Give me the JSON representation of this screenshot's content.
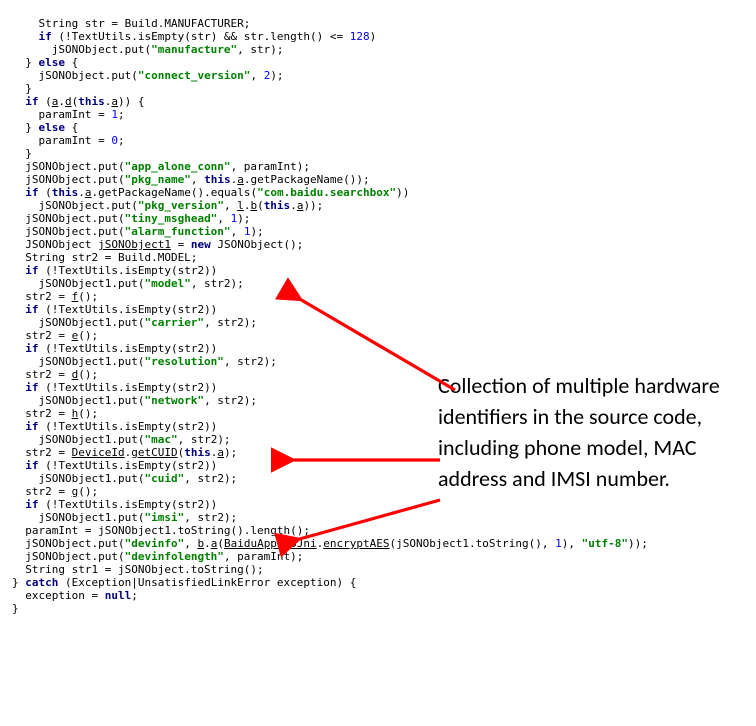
{
  "callout_text": "Collection of multiple hardware identifiers in the source code, including phone model, MAC address and IMSI number.",
  "code": {
    "lines": [
      "    String str = Build.MANUFACTURER;",
      "    if (!TextUtils.isEmpty(str) && str.length() <= 128)",
      "      jSONObject.put(\"manufacture\", str);",
      "  } else {",
      "    jSONObject.put(\"connect_version\", 2);",
      "  }",
      "  if (a.d(this.a)) {",
      "    paramInt = 1;",
      "  } else {",
      "    paramInt = 0;",
      "  }",
      "  jSONObject.put(\"app_alone_conn\", paramInt);",
      "  jSONObject.put(\"pkg_name\", this.a.getPackageName());",
      "  if (this.a.getPackageName().equals(\"com.baidu.searchbox\"))",
      "    jSONObject.put(\"pkg_version\", l.b(this.a));",
      "  jSONObject.put(\"tiny_msghead\", 1);",
      "  jSONObject.put(\"alarm_function\", 1);",
      "  JSONObject jSONObject1 = new JSONObject();",
      "  String str2 = Build.MODEL;",
      "  if (!TextUtils.isEmpty(str2))",
      "    jSONObject1.put(\"model\", str2);",
      "  str2 = f();",
      "  if (!TextUtils.isEmpty(str2))",
      "    jSONObject1.put(\"carrier\", str2);",
      "  str2 = e();",
      "  if (!TextUtils.isEmpty(str2))",
      "    jSONObject1.put(\"resolution\", str2);",
      "  str2 = d();",
      "  if (!TextUtils.isEmpty(str2))",
      "    jSONObject1.put(\"network\", str2);",
      "  str2 = h();",
      "  if (!TextUtils.isEmpty(str2))",
      "    jSONObject1.put(\"mac\", str2);",
      "  str2 = DeviceId.getCUID(this.a);",
      "  if (!TextUtils.isEmpty(str2))",
      "    jSONObject1.put(\"cuid\", str2);",
      "  str2 = g();",
      "  if (!TextUtils.isEmpty(str2))",
      "    jSONObject1.put(\"imsi\", str2);",
      "  paramInt = jSONObject1.toString().length();",
      "  jSONObject.put(\"devinfo\", b.a(BaiduAppSSOJni.encryptAES(jSONObject1.toString(), 1), \"utf-8\"));",
      "  jSONObject.put(\"devinfolength\", paramInt);",
      "  String str1 = jSONObject.toString();",
      "} catch (Exception|UnsatisfiedLinkError exception) {",
      "  exception = null;",
      "}"
    ]
  }
}
